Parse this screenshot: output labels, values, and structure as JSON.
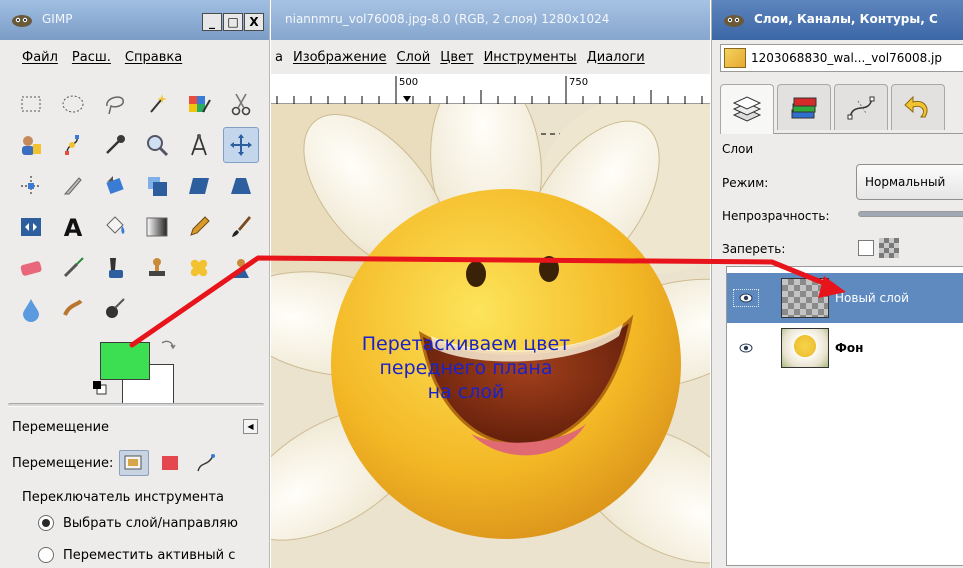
{
  "toolbox": {
    "title": "GIMP",
    "window_buttons": [
      "_",
      "□",
      "X"
    ],
    "menu": [
      "Файл",
      "Расш.",
      "Справка"
    ],
    "foreground_color": "#3ddf52",
    "background_color": "#ffffff",
    "options": {
      "title": "Перемещение",
      "move_label": "Перемещение:",
      "switch_label": "Переключатель инструмента",
      "radio_pick_layer": "Выбрать слой/направляю",
      "radio_move_active": "Переместить активный с"
    }
  },
  "image_window": {
    "title": "niannmru_vol76008.jpg-8.0 (RGB, 2 слоя) 1280x1024",
    "menu": [
      "а",
      "Изображение",
      "Слой",
      "Цвет",
      "Инструменты",
      "Диалоги"
    ],
    "ruler_labels": [
      "500",
      "750"
    ],
    "overlay_text": [
      "Перетаскиваем цвет",
      "переднего плана",
      "на слой"
    ]
  },
  "layers_dock": {
    "title": "Слои, Каналы, Контуры, С",
    "image_selector": "1203068830_wal..._vol76008.jp",
    "tabs": [
      "layers-icon",
      "channels-icon",
      "paths-icon",
      "undo-icon"
    ],
    "layers_label": "Слои",
    "mode_label": "Режим:",
    "mode_value": "Нормальный",
    "opacity_label": "Непрозрачность:",
    "opacity_percent": 100,
    "lock_label": "Запереть:",
    "layers": [
      {
        "name": "Новый слой",
        "selected": true,
        "thumb": "transparent"
      },
      {
        "name": "Фон",
        "selected": false,
        "thumb": "photo"
      }
    ]
  },
  "annotation": {
    "arrow_color": "#e8141b"
  }
}
